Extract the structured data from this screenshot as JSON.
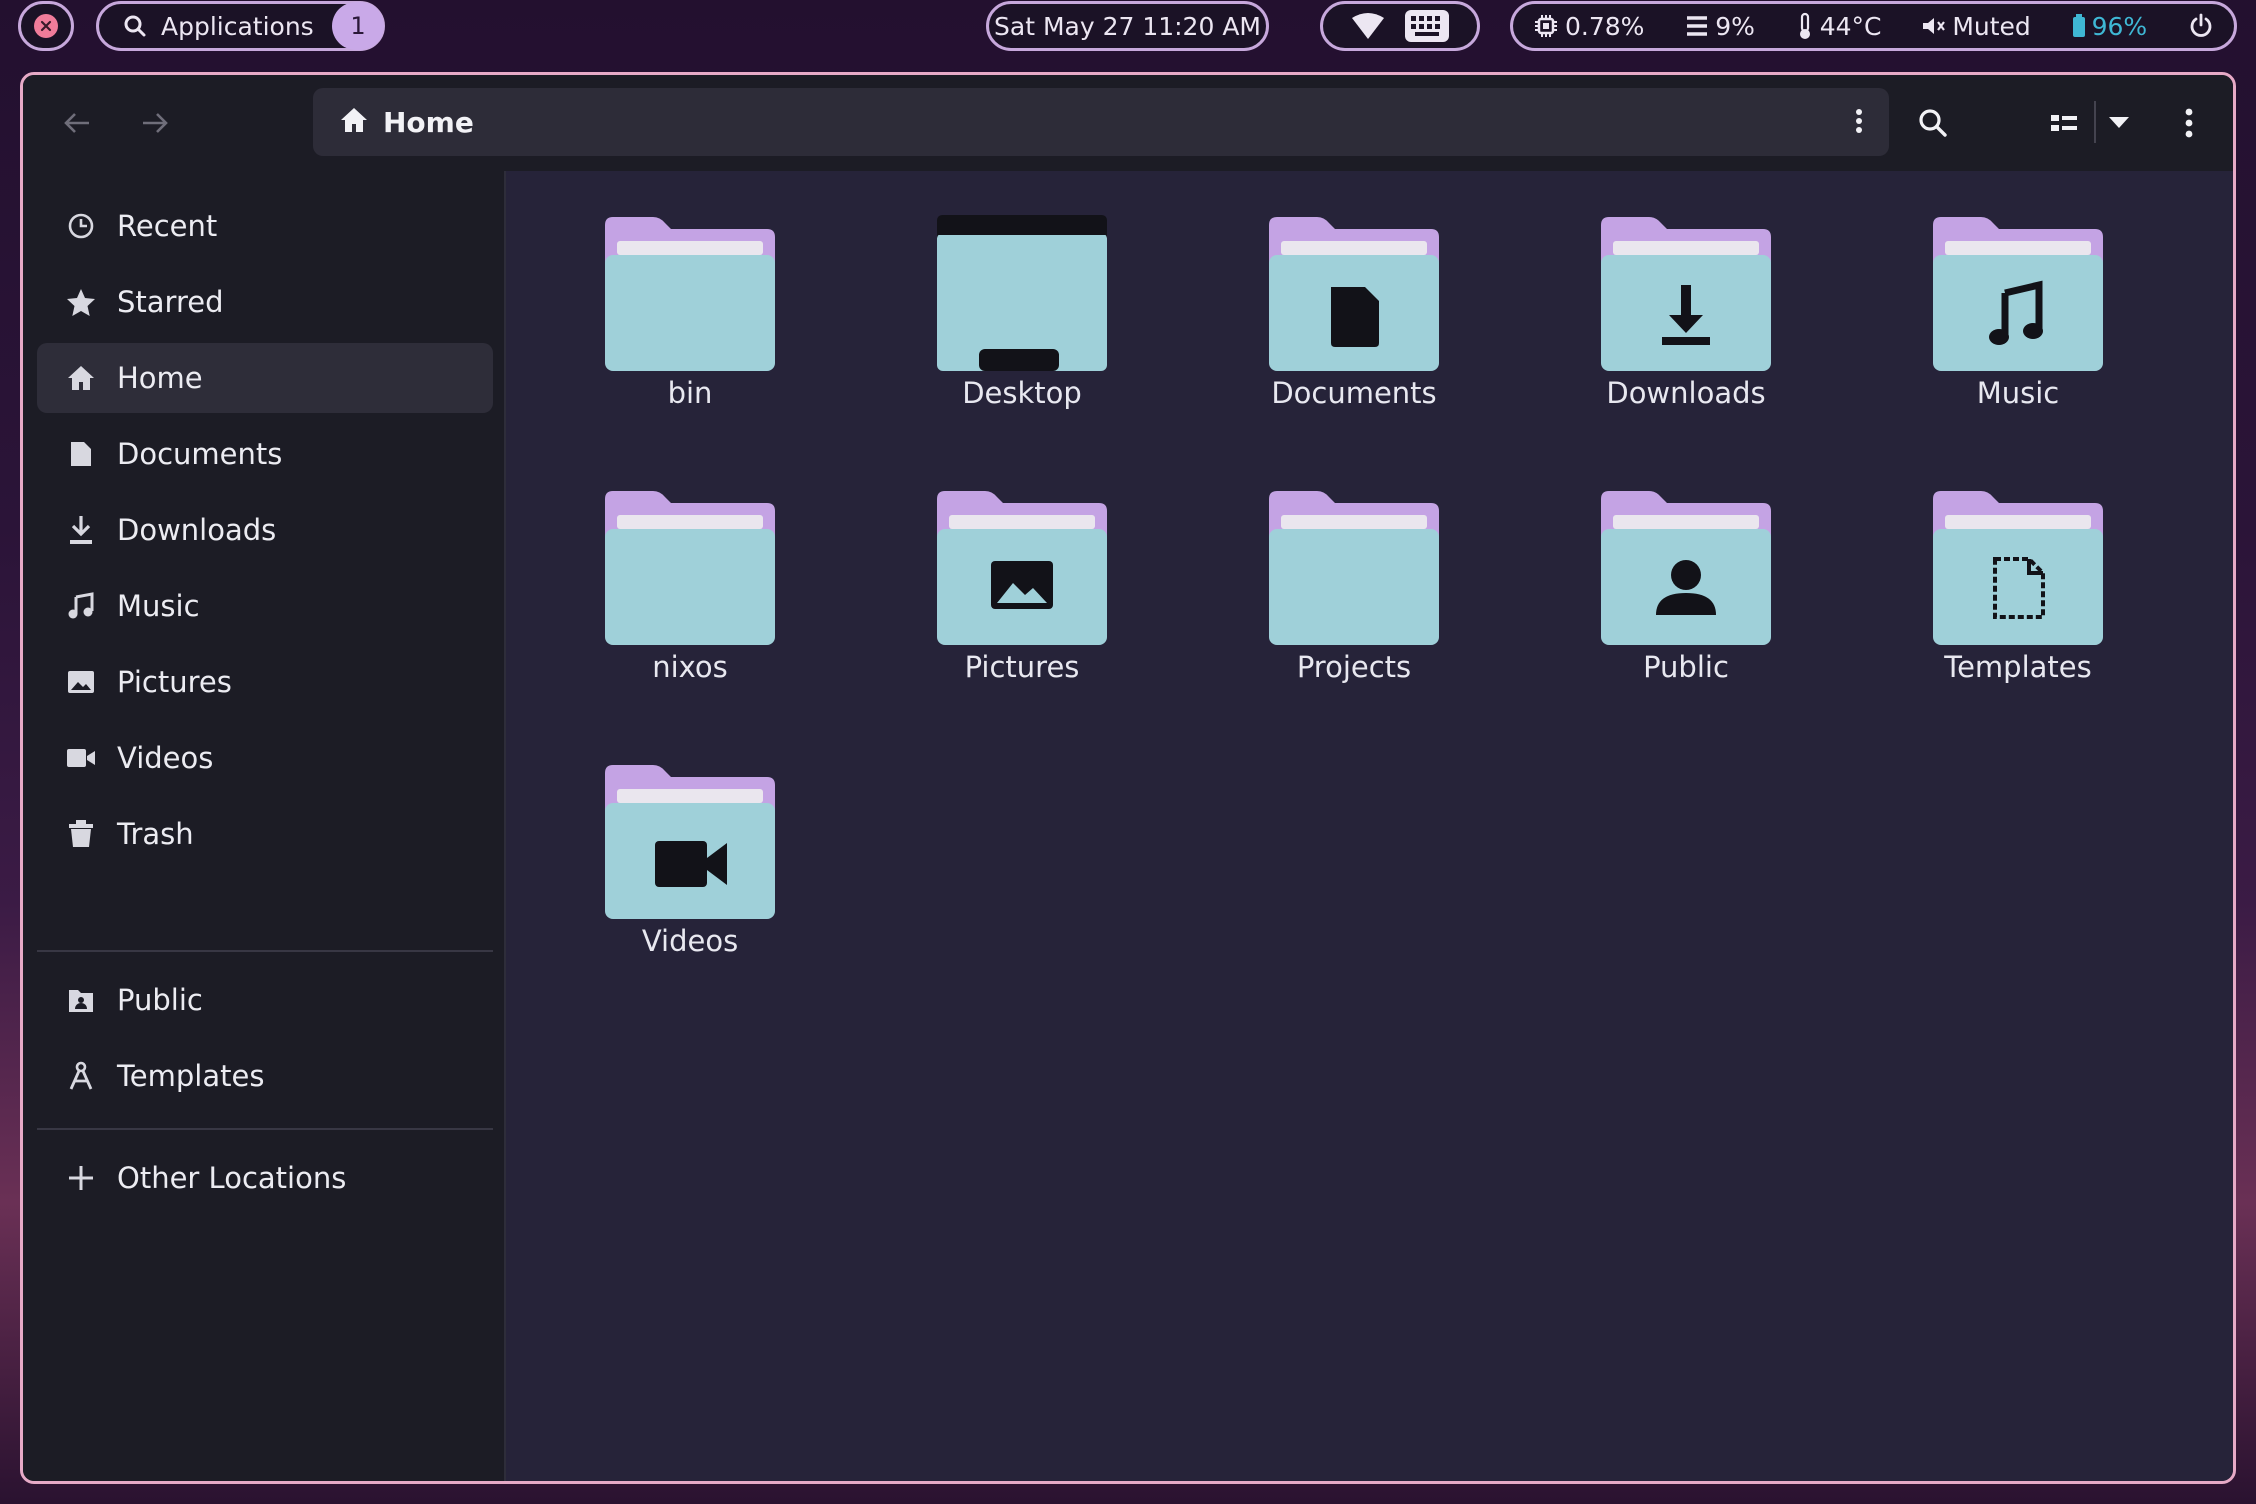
{
  "topbar": {
    "applications_label": "Applications",
    "workspace_number": "1",
    "clock": "Sat May 27 11:20 AM",
    "cpu": "0.78%",
    "memory": "9%",
    "temperature": "44°C",
    "volume": "Muted",
    "battery": "96%"
  },
  "headerbar": {
    "path_label": "Home"
  },
  "sidebar": {
    "items": [
      {
        "label": "Recent",
        "icon": "clock-icon"
      },
      {
        "label": "Starred",
        "icon": "star-icon"
      },
      {
        "label": "Home",
        "icon": "home-icon",
        "active": true
      },
      {
        "label": "Documents",
        "icon": "document-icon"
      },
      {
        "label": "Downloads",
        "icon": "download-icon"
      },
      {
        "label": "Music",
        "icon": "music-icon"
      },
      {
        "label": "Pictures",
        "icon": "picture-icon"
      },
      {
        "label": "Videos",
        "icon": "video-icon"
      },
      {
        "label": "Trash",
        "icon": "trash-icon"
      }
    ],
    "bookmarks": [
      {
        "label": "Public",
        "icon": "public-icon"
      },
      {
        "label": "Templates",
        "icon": "templates-icon"
      }
    ],
    "other_locations": {
      "label": "Other Locations",
      "icon": "plus-icon"
    }
  },
  "files": [
    {
      "name": "bin",
      "emblem": "none"
    },
    {
      "name": "Desktop",
      "emblem": "desktop"
    },
    {
      "name": "Documents",
      "emblem": "document"
    },
    {
      "name": "Downloads",
      "emblem": "download"
    },
    {
      "name": "Music",
      "emblem": "music"
    },
    {
      "name": "nixos",
      "emblem": "none"
    },
    {
      "name": "Pictures",
      "emblem": "picture"
    },
    {
      "name": "Projects",
      "emblem": "none"
    },
    {
      "name": "Public",
      "emblem": "person"
    },
    {
      "name": "Templates",
      "emblem": "template"
    },
    {
      "name": "Videos",
      "emblem": "video"
    }
  ],
  "colors": {
    "accent_border": "#e7aac7",
    "folder_body": "#9fd0d9",
    "folder_tab": "#c4a3e4",
    "sidebar_bg": "#1c1c25",
    "content_bg": "#262339"
  }
}
